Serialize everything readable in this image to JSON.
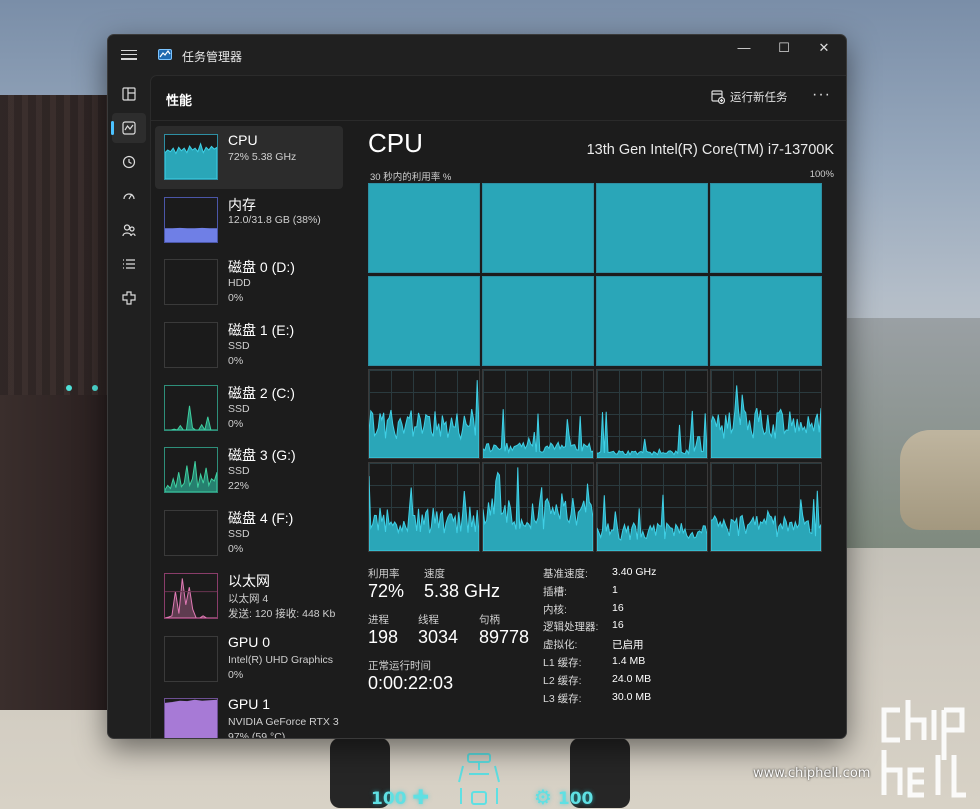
{
  "window": {
    "title": "任务管理器",
    "controls": {
      "minimize": "—",
      "maximize": "☐",
      "close": "✕"
    }
  },
  "nav": [
    {
      "name": "processes-icon",
      "active": false
    },
    {
      "name": "performance-icon",
      "active": true
    },
    {
      "name": "app-history-icon",
      "active": false
    },
    {
      "name": "startup-apps-icon",
      "active": false
    },
    {
      "name": "users-icon",
      "active": false
    },
    {
      "name": "details-icon",
      "active": false
    },
    {
      "name": "services-icon",
      "active": false
    }
  ],
  "header": {
    "title": "性能",
    "run_task": "运行新任务",
    "more": "···"
  },
  "devices": [
    {
      "name": "CPU",
      "l1": "72%  5.38 GHz",
      "l2": "",
      "thumb": "cpu"
    },
    {
      "name": "内存",
      "l1": "12.0/31.8 GB (38%)",
      "l2": "",
      "thumb": "memory"
    },
    {
      "name": "磁盘 0 (D:)",
      "l1": "HDD",
      "l2": "0%",
      "thumb": "empty"
    },
    {
      "name": "磁盘 1 (E:)",
      "l1": "SSD",
      "l2": "0%",
      "thumb": "empty"
    },
    {
      "name": "磁盘 2 (C:)",
      "l1": "SSD",
      "l2": "0%",
      "thumb": "disk-spike"
    },
    {
      "name": "磁盘 3 (G:)",
      "l1": "SSD",
      "l2": "22%",
      "thumb": "disk-active"
    },
    {
      "name": "磁盘 4 (F:)",
      "l1": "SSD",
      "l2": "0%",
      "thumb": "empty"
    },
    {
      "name": "以太网",
      "l1": "以太网 4",
      "l2": "发送: 120  接收: 448 Kb",
      "thumb": "ethernet"
    },
    {
      "name": "GPU 0",
      "l1": "Intel(R) UHD Graphics",
      "l2": "0%",
      "thumb": "empty"
    },
    {
      "name": "GPU 1",
      "l1": "NVIDIA GeForce RTX 3",
      "l2": "97% (59 °C)",
      "thumb": "gpu"
    }
  ],
  "cpu": {
    "title": "CPU",
    "model": "13th Gen Intel(R) Core(TM) i7-13700K",
    "graph_label": "30 秒内的利用率 %",
    "graph_max": "100%",
    "utilization_label": "利用率",
    "utilization": "72%",
    "speed_label": "速度",
    "speed": "5.38 GHz",
    "processes_label": "进程",
    "processes": "198",
    "threads_label": "线程",
    "threads": "3034",
    "handles_label": "句柄",
    "handles": "89778",
    "uptime_label": "正常运行时间",
    "uptime": "0:00:22:03",
    "specs": [
      {
        "k": "基准速度:",
        "v": "3.40 GHz"
      },
      {
        "k": "插槽:",
        "v": "1"
      },
      {
        "k": "内核:",
        "v": "16"
      },
      {
        "k": "逻辑处理器:",
        "v": "16"
      },
      {
        "k": "虚拟化:",
        "v": "已启用"
      },
      {
        "k": "L1 缓存:",
        "v": "1.4 MB"
      },
      {
        "k": "L2 缓存:",
        "v": "24.0 MB"
      },
      {
        "k": "L3 缓存:",
        "v": "30.0 MB"
      }
    ],
    "core_levels": [
      100,
      100,
      100,
      100,
      100,
      100,
      100,
      100,
      38,
      12,
      6,
      40,
      35,
      42,
      22,
      28
    ]
  },
  "colors": {
    "accent": "#4cc2ff",
    "cpu_fill": "#2aa6b8",
    "cpu_line": "#3fd0e6",
    "memory": "#6f7fe6",
    "ethernet": "#e07ab5",
    "gpu": "#a77ad6"
  },
  "hud": {
    "health": "100",
    "armor": "100"
  },
  "watermark": {
    "url": "www.chiphell.com"
  }
}
